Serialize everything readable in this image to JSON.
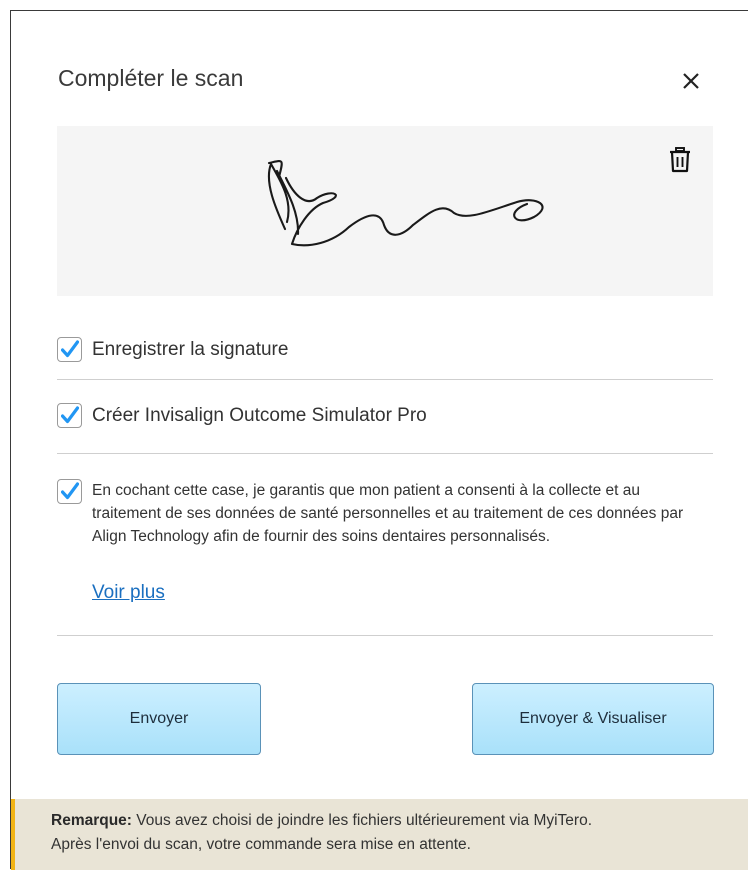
{
  "dialog": {
    "title": "Compléter le scan",
    "close_icon": "close-icon"
  },
  "signature": {
    "delete_icon": "trash-icon",
    "image": "handwritten-signature"
  },
  "options": [
    {
      "label": "Enregistrer la signature",
      "checked": true
    },
    {
      "label": "Créer Invisalign Outcome Simulator Pro",
      "checked": true
    }
  ],
  "consent": {
    "checked": true,
    "text": "En cochant cette case, je garantis que mon patient a consenti à la collecte et au traitement de ses données de santé personnelles et au traitement de ces données par Align Technology afin de fournir des soins dentaires personnalisés.",
    "link_label": "Voir plus"
  },
  "buttons": {
    "send_label": "Envoyer",
    "send_view_label": "Envoyer & Visualiser"
  },
  "note": {
    "prefix": "Remarque:",
    "line1": " Vous avez choisi de joindre les fichiers ultérieurement via MyiTero.",
    "line2": "Après l'envoi du scan, votre commande sera mise en attente."
  },
  "colors": {
    "checkbox_check": "#2196f3",
    "button_fill": "#b8e8fc",
    "button_border": "#5a92b8",
    "link": "#1a6fc0",
    "note_bg": "#e9e4d6",
    "note_accent": "#f2b416"
  }
}
